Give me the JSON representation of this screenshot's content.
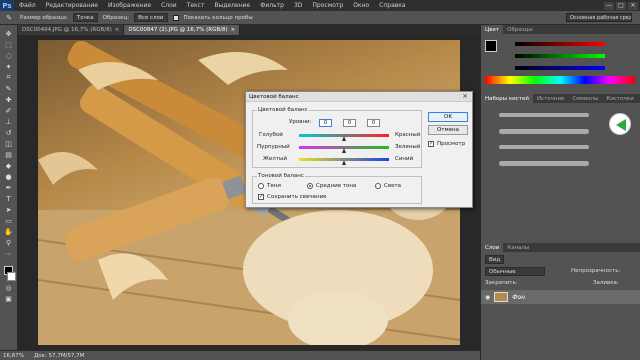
{
  "menubar": {
    "logo": "Ps",
    "items": [
      "Файл",
      "Редактирование",
      "Изображение",
      "Слои",
      "Текст",
      "Выделение",
      "Фильтр",
      "3D",
      "Просмотр",
      "Окно",
      "Справка"
    ],
    "win_controls": [
      "—",
      "□",
      "✕"
    ]
  },
  "options": {
    "sample_size_label": "Размер образца:",
    "sample_size_value": "Точка",
    "sample_label": "Образец:",
    "sample_value": "Все слои",
    "show_ring": "Показать кольцо пробы"
  },
  "workspace": "Основная рабочая среда",
  "tabs": [
    {
      "label": "DSC00494.JPG @ 16,7% (RGB/8)",
      "close": "×"
    },
    {
      "label": "DSC00847 (2).JPG @ 16,7% (RGB/8)",
      "close": "×"
    }
  ],
  "status": {
    "zoom": "16,67%",
    "doc": "Док: 57,7M/57,7M"
  },
  "right_panel": {
    "color_tabs": [
      "Цвет",
      "Образцы"
    ],
    "brush_tabs": [
      "Наборы кистей",
      "Источник",
      "Символы",
      "Кисточки"
    ],
    "layers_tabs": [
      "Слои",
      "Каналы"
    ],
    "layer_kind": "Вид",
    "blend_mode": "Обычные",
    "opacity_label": "Непрозрачность:",
    "lock_label": "Закрепить:",
    "fill_label": "Заливка:",
    "layer_name": "Фон"
  },
  "dialog": {
    "title": "Цветовой баланс",
    "balance_group": "Цветовой баланс",
    "levels_label": "Уровни:",
    "levels": [
      "0",
      "0",
      "0"
    ],
    "rows": [
      {
        "left": "Голубой",
        "right": "Красный"
      },
      {
        "left": "Пурпурный",
        "right": "Зеленый"
      },
      {
        "left": "Желтый",
        "right": "Синий"
      }
    ],
    "tone_group": "Тоновой баланс",
    "tones": [
      "Тени",
      "Средние тона",
      "Света"
    ],
    "preserve": "Сохранить свечение",
    "ok": "OK",
    "cancel": "Отмена",
    "preview": "Просмотр"
  }
}
